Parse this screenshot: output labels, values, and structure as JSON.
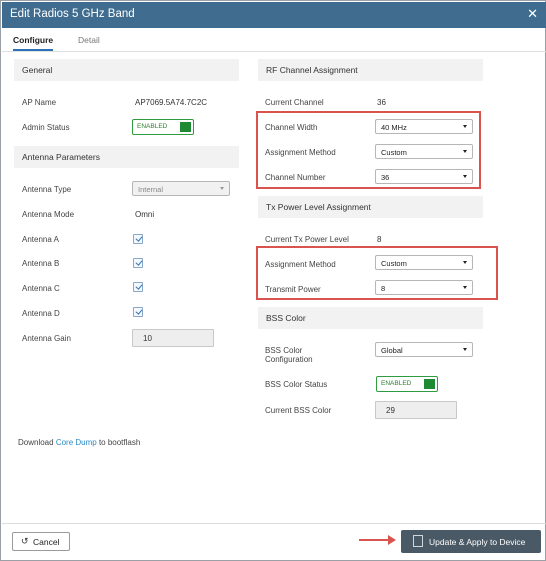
{
  "window": {
    "title": "Edit Radios 5 GHz Band",
    "close_icon": "close-icon"
  },
  "tabs": [
    {
      "label": "Configure",
      "active": true
    },
    {
      "label": "Detail",
      "active": false
    }
  ],
  "general": {
    "header": "General",
    "ap_name_label": "AP Name",
    "ap_name_value": "AP7069.5A74.7C2C",
    "admin_status_label": "Admin Status",
    "admin_status_value": "ENABLED"
  },
  "antenna": {
    "header": "Antenna Parameters",
    "type_label": "Antenna Type",
    "type_value": "Internal",
    "mode_label": "Antenna Mode",
    "mode_value": "Omni",
    "a_label": "Antenna A",
    "b_label": "Antenna B",
    "c_label": "Antenna C",
    "d_label": "Antenna D",
    "gain_label": "Antenna Gain",
    "gain_value": "10"
  },
  "download": {
    "prefix": "Download ",
    "link": "Core Dump",
    "suffix": " to bootflash"
  },
  "rf": {
    "header": "RF Channel Assignment",
    "current_channel_label": "Current Channel",
    "current_channel_value": "36",
    "width_label": "Channel Width",
    "width_value": "40 MHz",
    "method_label": "Assignment Method",
    "method_value": "Custom",
    "number_label": "Channel Number",
    "number_value": "36"
  },
  "tx": {
    "header": "Tx Power Level Assignment",
    "current_label": "Current Tx Power Level",
    "current_value": "8",
    "method_label": "Assignment Method",
    "method_value": "Custom",
    "power_label": "Transmit Power",
    "power_value": "8"
  },
  "bss": {
    "header": "BSS Color",
    "config_label_1": "BSS Color",
    "config_label_2": "Configuration",
    "config_value": "Global",
    "status_label": "BSS Color Status",
    "status_value": "ENABLED",
    "current_label": "Current BSS Color",
    "current_value": "29"
  },
  "footer": {
    "cancel_label": "Cancel",
    "update_label": "Update & Apply to Device"
  },
  "colors": {
    "titlebar": "#3f6c8f",
    "accent": "#2a72b5",
    "enabled_green": "#1f8a34",
    "highlight_red": "#d9534f",
    "update_button": "#4a5966"
  }
}
